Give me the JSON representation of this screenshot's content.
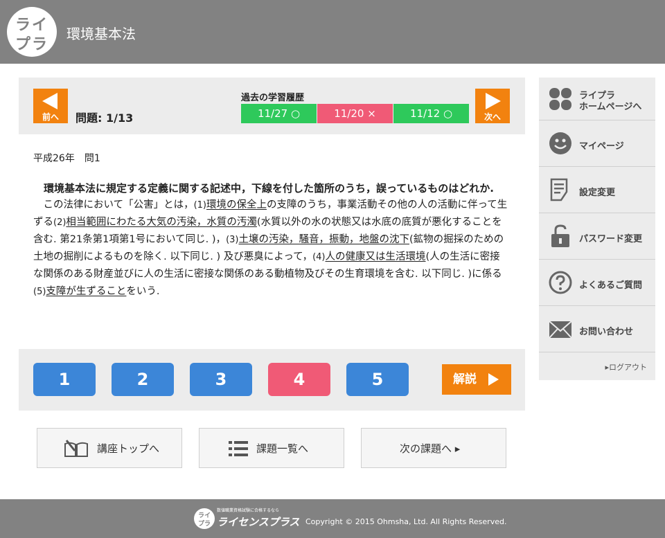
{
  "header": {
    "logo_top": "ライ",
    "logo_bottom": "プラ",
    "title": "環境基本法"
  },
  "nav": {
    "prev_label": "前へ",
    "next_label": "次へ",
    "question_counter": "問題: 1/13"
  },
  "history": {
    "title": "過去の学習履歴",
    "items": [
      {
        "label": "11/27 ○",
        "status": "ok"
      },
      {
        "label": "11/20 ×",
        "status": "ng"
      },
      {
        "label": "11/12 ○",
        "status": "ok"
      }
    ]
  },
  "question": {
    "year": "平成26年　問1",
    "prompt": "環境基本法に規定する定義に関する記述中，下線を付した箇所のうち，誤っているものはどれか.",
    "body": {
      "t0": "この法律において「公害」とは，",
      "n1": "(1)",
      "u1": "環境の保全上",
      "t1": "の支障のうち，事業活動その他の人の活動に伴って生ずる",
      "n2": "(2)",
      "u2": "相当範囲にわたる大気の汚染，水質の汚濁",
      "t2": "(水質以外の水の状態又は水底の底質が悪化することを含む. 第21条第1項第1号において同じ. )，",
      "n3": "(3)",
      "u3": "土壌の汚染，騒音，振動，地盤の沈下",
      "t3": "(鉱物の掘採のための土地の掘削によるものを除く. 以下同じ. ) 及び悪臭によって，",
      "n4": "(4)",
      "u4": "人の健康又は生活環境",
      "t4": "(人の生活に密接な関係のある財産並びに人の生活に密接な関係のある動植物及びその生育環境を含む. 以下同じ. )に係る",
      "n5": "(5)",
      "u5": "支障が生ずること",
      "t5": "をいう."
    }
  },
  "answers": {
    "options": [
      "1",
      "2",
      "3",
      "4",
      "5"
    ],
    "selected": "4",
    "explain_label": "解説"
  },
  "bottom_buttons": {
    "course_top": "講座トップへ",
    "task_list": "課題一覧へ",
    "next_task": "次の課題へ ▸"
  },
  "sidebar": {
    "home": "ライプラ\nホームページへ",
    "home_line1": "ライプラ",
    "home_line2": "ホームページへ",
    "mypage": "マイページ",
    "settings": "設定変更",
    "password": "パスワード変更",
    "faq": "よくあるご質問",
    "contact": "お問い合わせ",
    "logout": "▸ログアウト"
  },
  "footer": {
    "logo_top": "ライ",
    "logo_bottom": "プラ",
    "tagline": "数値職業資格試験に合格するなら",
    "brand": "ライセンスプラス",
    "copyright": "Copyright © 2015 Ohmsha, Ltd. All Rights Reserved."
  },
  "colors": {
    "header_bg": "#828282",
    "orange": "#f2820f",
    "green": "#2ec95b",
    "red": "#f05a76",
    "blue": "#3c86d8",
    "panel_bg": "#ececec"
  }
}
